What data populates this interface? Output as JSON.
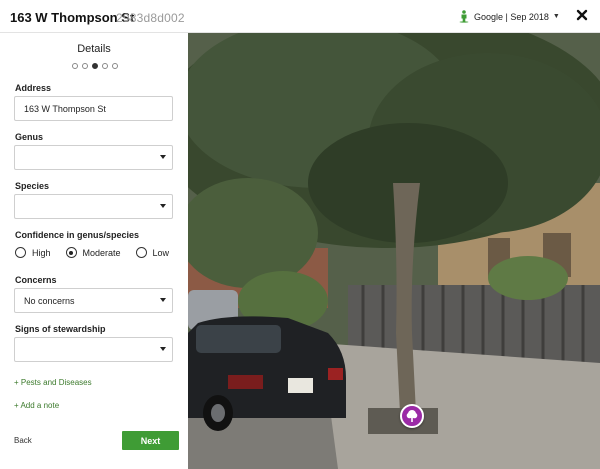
{
  "header": {
    "title": "163 W Thompson St",
    "record_id": "2983d8d002",
    "imagery_source": "Google | Sep 2018",
    "close_icon": "close-icon",
    "source_icon": "street-view-person-icon"
  },
  "panel": {
    "title": "Details",
    "steps_total": 5,
    "steps_active": 3,
    "address": {
      "label": "Address",
      "value": "163 W Thompson St"
    },
    "genus": {
      "label": "Genus",
      "value": ""
    },
    "species": {
      "label": "Species",
      "value": ""
    },
    "confidence": {
      "label": "Confidence in genus/species",
      "options": [
        "High",
        "Moderate",
        "Low"
      ],
      "selected": "Moderate"
    },
    "concerns": {
      "label": "Concerns",
      "value": "No concerns"
    },
    "stewardship": {
      "label": "Signs of stewardship",
      "value": ""
    },
    "pests_link": "+ Pests and Diseases",
    "note_link": "+ Add a note",
    "back_label": "Back",
    "next_label": "Next"
  },
  "colors": {
    "accent_green": "#3f9c35",
    "link_green": "#3c7a2c",
    "marker_purple": "#9b2aa6"
  },
  "map": {
    "marker_icon": "tree-icon"
  }
}
